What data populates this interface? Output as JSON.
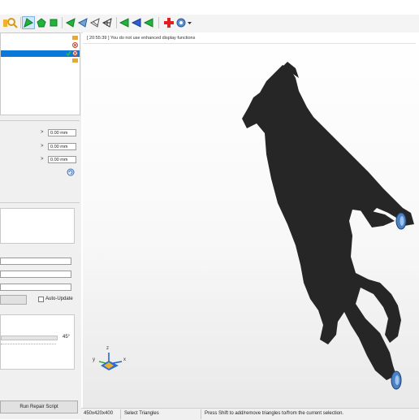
{
  "toolbar": {
    "icons": [
      "folder-icon",
      "search-icon",
      "select-triangle-icon",
      "select-surface-icon",
      "select-shell-icon",
      "shade-icon-1",
      "shade-icon-2",
      "shade-icon-3",
      "shade-icon-4",
      "nav-left-icon",
      "nav-down-icon",
      "nav-right-icon",
      "add-red-cross-icon",
      "help-icon"
    ]
  },
  "parts": {
    "selected_row": ""
  },
  "transform": {
    "x_value": "0.00 mm",
    "y_value": "0.00 mm",
    "z_value": "0.00 mm"
  },
  "panel": {
    "auto_update_label": "Auto-Update",
    "slider_value": "45°",
    "run_repair_label": "Run Repair Script"
  },
  "viewport": {
    "log_message": "[ 20:55:39 ] You do not use enhanced display functions",
    "axis_x": "x",
    "axis_y": "y",
    "axis_z": "z",
    "model_color": "#262626",
    "foot_color": "#4a82c8"
  },
  "status": {
    "dimensions": "450x420x400",
    "mode": "Select Triangles",
    "hint": "Press Shift to add/remove triangles to/from the current selection."
  }
}
